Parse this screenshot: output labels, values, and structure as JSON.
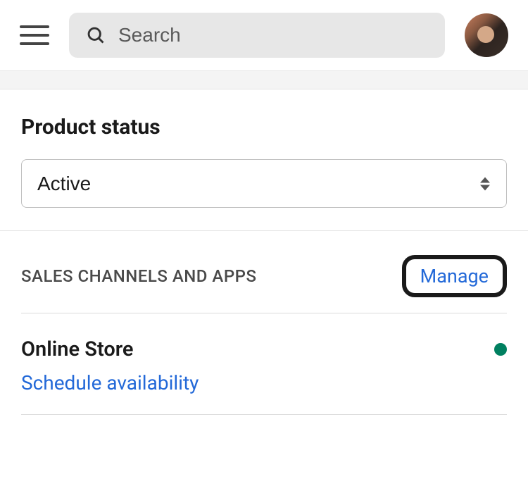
{
  "header": {
    "search_placeholder": "Search"
  },
  "status": {
    "title": "Product status",
    "selected": "Active"
  },
  "sales": {
    "title": "SALES CHANNELS AND APPS",
    "manage_label": "Manage",
    "channel": {
      "name": "Online Store",
      "status_color": "#008060"
    },
    "schedule_label": "Schedule availability"
  }
}
